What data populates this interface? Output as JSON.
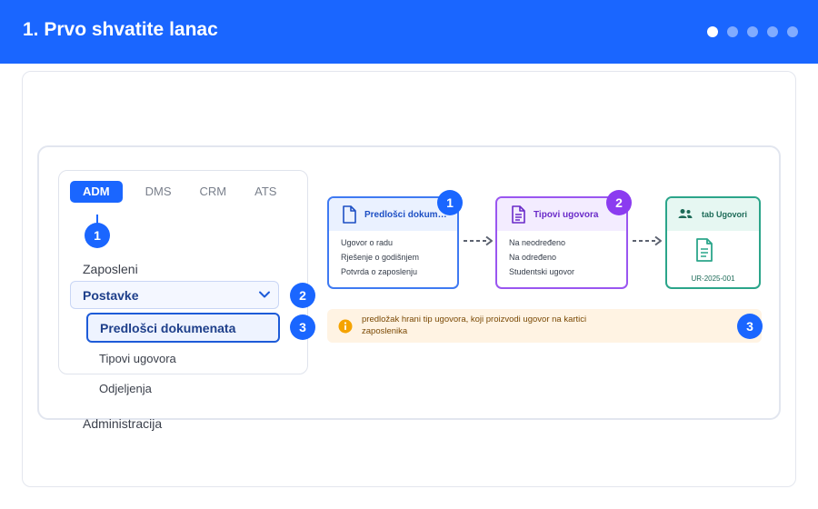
{
  "header": {
    "title": "1. Prvo shvatite lanac",
    "pagination": {
      "count": 5,
      "active_index": 1
    }
  },
  "sidebar": {
    "tabs": [
      "ADM",
      "DMS",
      "CRM",
      "ATS"
    ],
    "active_tab": "ADM",
    "items": {
      "zaposleni": "Zaposleni",
      "postavke": "Postavke",
      "predlosci": "Predlošci dokumenata",
      "tipovi": "Tipovi ugovora",
      "odjeljenja": "Odjeljenja",
      "administracija": "Administracija"
    }
  },
  "steps": {
    "one": "1",
    "two": "2",
    "three": "3"
  },
  "flow": {
    "card1": {
      "title": "Predlošci dokumenata",
      "icon": "document-icon",
      "lines": [
        "Ugovor o radu",
        "Rješenje o godišnjem",
        "Potvrda o zaposlenju"
      ]
    },
    "card2": {
      "title": "Tipovi ugovora",
      "icon": "document-lines-icon",
      "lines": [
        "Na neodređeno",
        "Na određeno",
        "Studentski ugovor"
      ]
    },
    "card3": {
      "title": "tab Ugovori",
      "icon": "users-icon",
      "code": "UR-2025-001"
    }
  },
  "note": {
    "text": "predložak hrani tip ugovora, koji proizvodi ugovor na kartici zaposlenika",
    "icon": "info-icon"
  },
  "colors": {
    "brand_blue": "#1a66ff",
    "purple": "#8b3cf0",
    "green": "#2ba58a",
    "note_bg": "#fff3e3"
  }
}
